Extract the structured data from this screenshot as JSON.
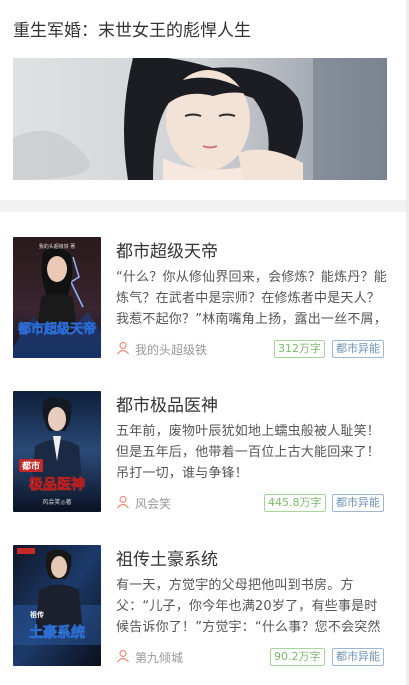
{
  "featured": {
    "title": "重生军婚：末世女王的彪悍人生"
  },
  "books": [
    {
      "title": "都市超级天帝",
      "description": "“什么？你从修仙界回来，会修炼？能炼丹？能炼气？在武者中是宗师？在修炼者中是天人？我惹不起你？”林南嘴角上扬，露出一丝不屑，",
      "author": "我的头超级铁",
      "words": "312万字",
      "genre": "都市异能",
      "cover_text": "都市超级天帝",
      "cover_small": "我的头超级铁 著"
    },
    {
      "title": "都市极品医神",
      "description": "五年前，废物叶辰犹如地上蠕虫般被人耻笑！但是五年后，他带着一百位上古大能回来了！吊打一切，谁与争锋！",
      "author": "风会笑",
      "words": "445.8万字",
      "genre": "都市异能",
      "cover_badge": "都市",
      "cover_text": "极品医神",
      "cover_small": "风会笑◎著"
    },
    {
      "title": "祖传土豪系统",
      "description": "有一天，方觉宇的父母把他叫到书房。方父：“儿子，你今年也满20岁了，有些事是时候告诉你了！”方觉宇：“什么事？您不会突然告",
      "author": "第九倾城",
      "words": "90.2万字",
      "genre": "都市异能",
      "cover_badge": "祖传",
      "cover_text": "土豪系统"
    }
  ]
}
